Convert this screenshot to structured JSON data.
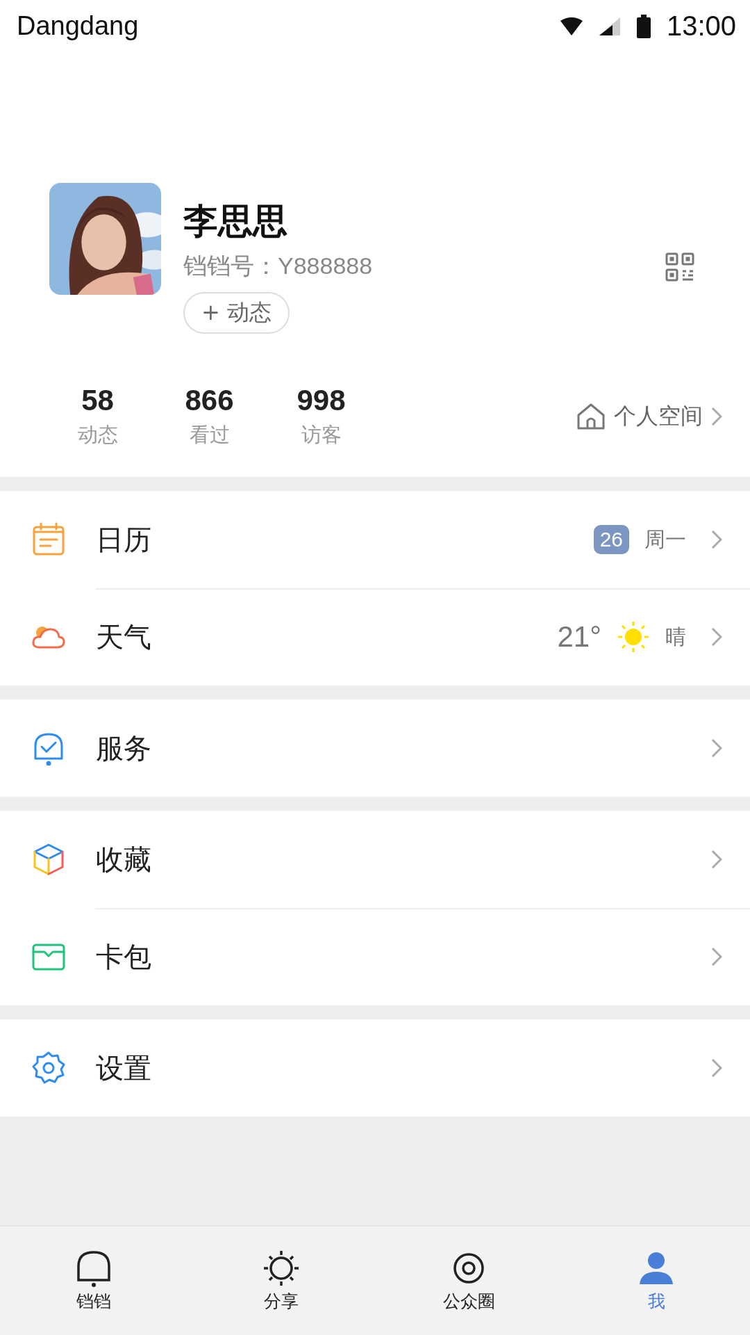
{
  "status_bar": {
    "app_name": "Dangdang",
    "time": "13:00"
  },
  "profile": {
    "name": "李思思",
    "account": "铛铛号：Y888888",
    "post_button": {
      "icon": "+",
      "label": "动态"
    }
  },
  "stats": [
    {
      "value": "58",
      "label": "动态"
    },
    {
      "value": "866",
      "label": "看过"
    },
    {
      "value": "998",
      "label": "访客"
    }
  ],
  "personal_space": {
    "label": "个人空间"
  },
  "sections": [
    {
      "items": [
        {
          "kind": "calendar",
          "label": "日历",
          "date": "26",
          "weekday": "周一"
        },
        {
          "kind": "weather",
          "label": "天气",
          "temperature": "21°",
          "condition": "晴"
        }
      ]
    },
    {
      "items": [
        {
          "kind": "service",
          "label": "服务"
        }
      ]
    },
    {
      "items": [
        {
          "kind": "favorites",
          "label": "收藏"
        },
        {
          "kind": "wallet",
          "label": "卡包"
        }
      ]
    },
    {
      "items": [
        {
          "kind": "settings",
          "label": "设置"
        }
      ]
    }
  ],
  "tab_bar": [
    {
      "kind": "bell",
      "label": "铛铛",
      "selected": false
    },
    {
      "kind": "sun",
      "label": "分享",
      "selected": false
    },
    {
      "kind": "circle",
      "label": "公众圈",
      "selected": false
    },
    {
      "kind": "person",
      "label": "我",
      "selected": true
    }
  ]
}
